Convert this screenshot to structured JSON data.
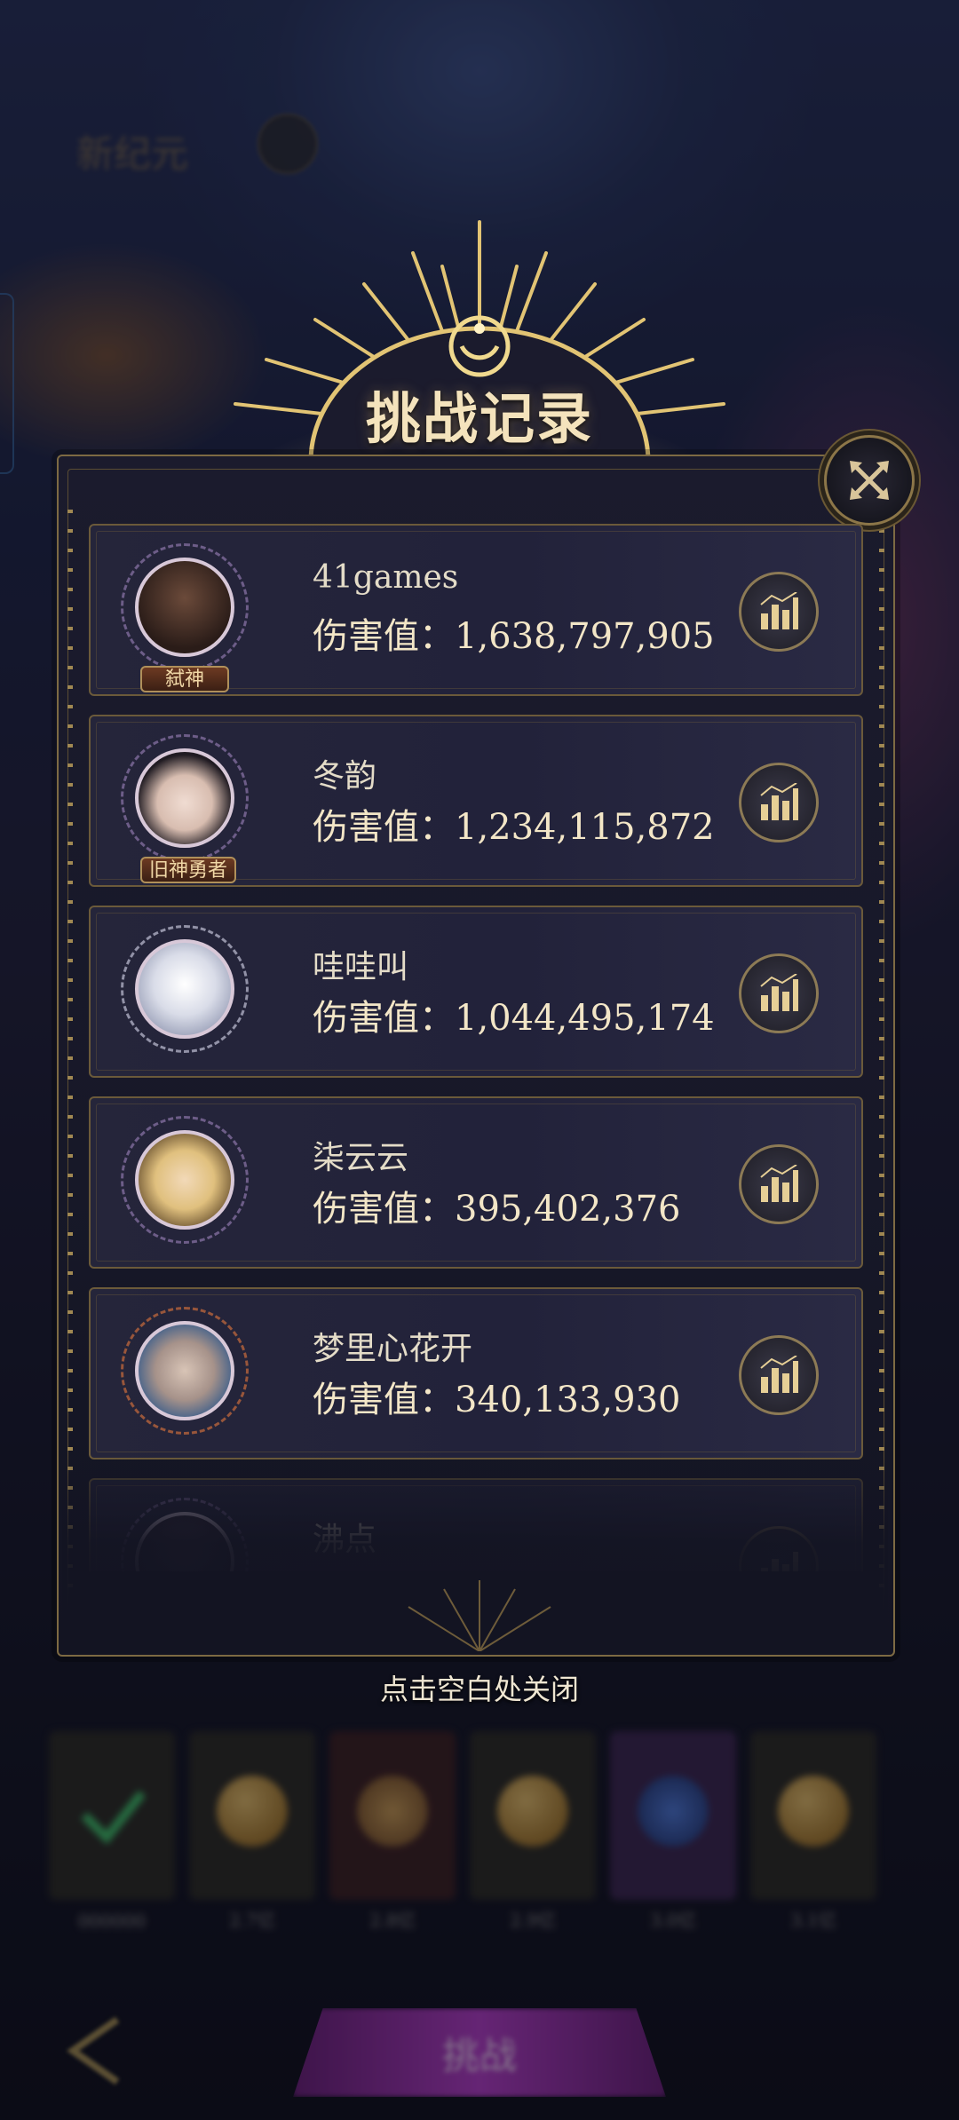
{
  "background": {
    "blurred_title": "新纪元",
    "reward_labels": [
      "000000",
      "2.7亿",
      "2.8亿",
      "2.9亿",
      "3.0亿",
      "3.1亿"
    ],
    "challenge_button_label": "挑战"
  },
  "modal": {
    "title": "挑战记录",
    "records": [
      {
        "name": "41games",
        "damage": "伤害值：1,638,797,905",
        "title_tag": "弑神",
        "avatar_color": "#3a2a2a"
      },
      {
        "name": "冬韵",
        "damage": "伤害值：1,234,115,872",
        "title_tag": "旧神勇者",
        "avatar_color": "#e9e2e2"
      },
      {
        "name": "哇哇叫",
        "damage": "伤害值：1,044,495,174",
        "title_tag": "",
        "avatar_color": "#cfd5e6"
      },
      {
        "name": "柒云云",
        "damage": "伤害值：395,402,376",
        "title_tag": "",
        "avatar_color": "#e6cf97"
      },
      {
        "name": "梦里心花开",
        "damage": "伤害值：340,133,930",
        "title_tag": "",
        "avatar_color": "#c9b6a8"
      },
      {
        "name": "沸点",
        "damage": "",
        "title_tag": "",
        "avatar_color": "#3a3140"
      }
    ],
    "close_hint": "点击空白处关闭"
  },
  "colors": {
    "gold": "#d9b86a",
    "text": "#f3e6c7"
  }
}
